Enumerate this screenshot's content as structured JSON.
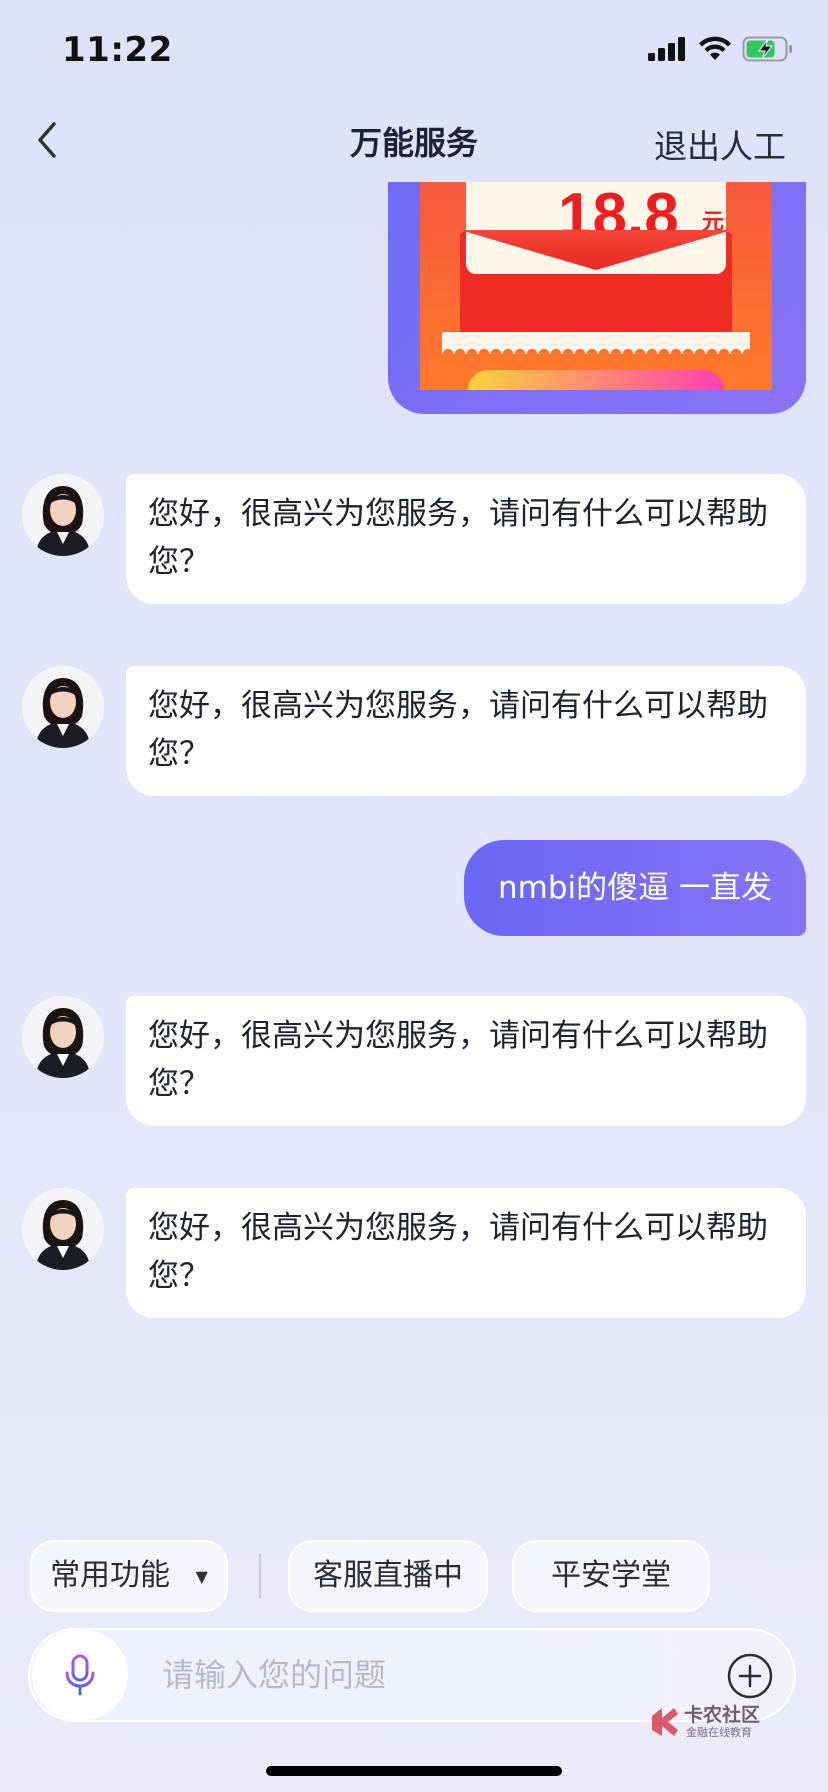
{
  "status_bar": {
    "time": "11:22"
  },
  "nav": {
    "title": "万能服务",
    "exit_label": "退出人工"
  },
  "image_card": {
    "amount": "18.8",
    "unit": "元"
  },
  "messages": [
    {
      "from": "bot",
      "text": "您好，很高兴为您服务，请问有什么可以帮助您？"
    },
    {
      "from": "bot",
      "text": "您好，很高兴为您服务，请问有什么可以帮助您？"
    },
    {
      "from": "user",
      "text": "nmbi的傻逼 一直发"
    },
    {
      "from": "bot",
      "text": "您好，很高兴为您服务，请问有什么可以帮助您？"
    },
    {
      "from": "bot",
      "text": "您好，很高兴为您服务，请问有什么可以帮助您？"
    }
  ],
  "quick_actions": {
    "common": "常用功能",
    "live": "客服直播中",
    "academy": "平安学堂"
  },
  "input": {
    "placeholder": "请输入您的问题"
  },
  "watermark": {
    "title": "卡农社区",
    "subtitle": "金融在线教育"
  },
  "colors": {
    "accent": "#6b66f6",
    "background": "#e0e2fb"
  }
}
